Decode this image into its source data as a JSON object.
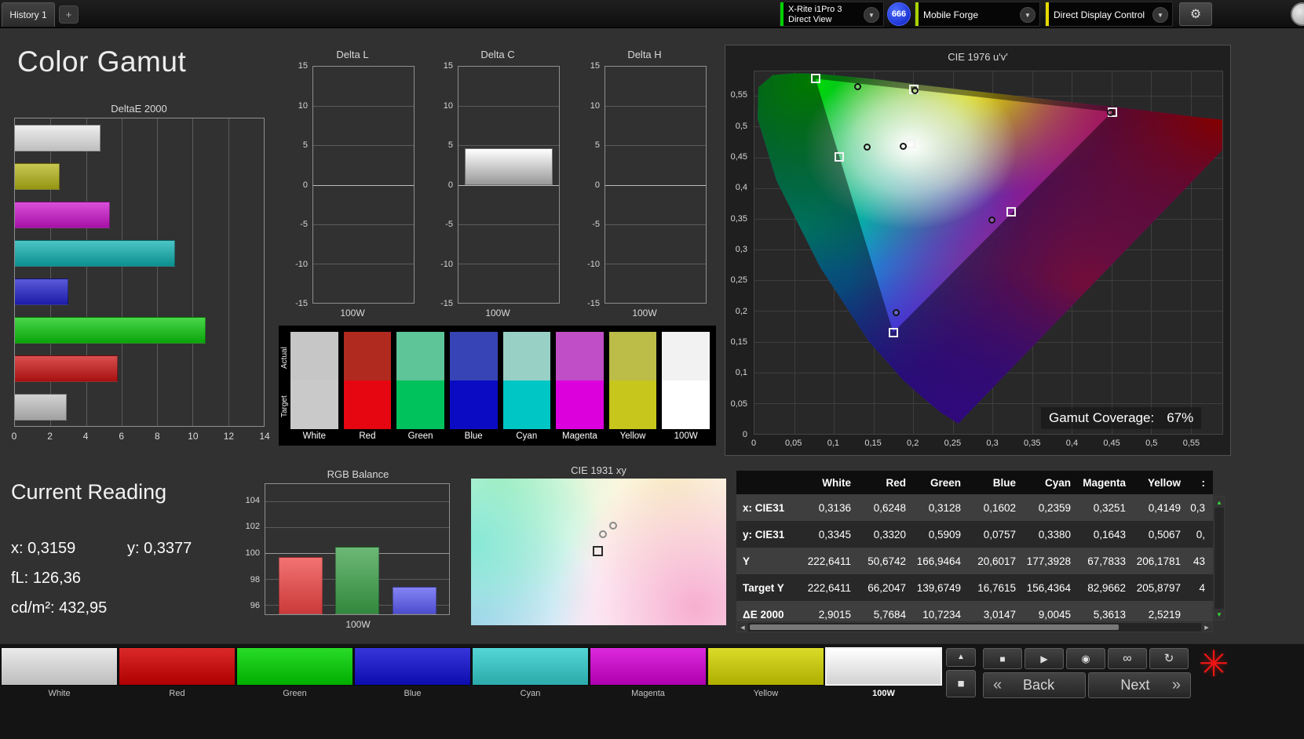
{
  "colors": {
    "accent_green": "#00d200",
    "accent_lime": "#a8d400",
    "accent_yellow": "#e8d800",
    "badge_blue": "#1f3fe8",
    "asterisk_red": "#f01414"
  },
  "icons": {
    "gear": "⚙",
    "chevron_down": "▼",
    "triangle_up": "▲",
    "triangle_down": "▼",
    "triangle_left": "◀",
    "triangle_right": "▶",
    "square": "■",
    "stop": "■",
    "play": "▶",
    "record": "◉",
    "infinity": "∞",
    "refresh": "↻",
    "asterisk": "✳"
  },
  "topbar": {
    "history_tab": "History 1",
    "add_tab": "+",
    "meter_line1": "X-Rite i1Pro 3",
    "meter_line2": "Direct View",
    "badge": "666",
    "pattern_source": "Mobile Forge",
    "display_control": "Direct Display Control"
  },
  "page_title": "Color Gamut",
  "chart_data": [
    {
      "id": "deltae2000",
      "type": "bar",
      "orientation": "horizontal",
      "title": "DeltaE 2000",
      "categories": [
        "100W",
        "Yellow",
        "Magenta",
        "Cyan",
        "Blue",
        "Green",
        "Red",
        "White"
      ],
      "values": [
        4.8,
        2.5219,
        5.3613,
        9.0045,
        3.0147,
        10.7234,
        5.7684,
        2.9015
      ],
      "bar_colors": [
        "#e8e8e8",
        "#b5b518",
        "#cc14cc",
        "#0fb0b0",
        "#2222cc",
        "#0cc80c",
        "#cc1414",
        "#c4c4c4"
      ],
      "xlim": [
        0,
        14
      ],
      "xticks": [
        0,
        2,
        4,
        6,
        8,
        10,
        12,
        14
      ]
    },
    {
      "id": "delta_l",
      "type": "bar",
      "title": "Delta L",
      "categories": [
        "100W"
      ],
      "values": [
        0
      ],
      "ylim": [
        -15,
        15
      ],
      "yticks": [
        15,
        10,
        5,
        0,
        -5,
        -10,
        -15
      ],
      "xlabel": "100W"
    },
    {
      "id": "delta_c",
      "type": "bar",
      "title": "Delta C",
      "categories": [
        "100W"
      ],
      "values": [
        4.6
      ],
      "ylim": [
        -15,
        15
      ],
      "yticks": [
        15,
        10,
        5,
        0,
        -5,
        -10,
        -15
      ],
      "xlabel": "100W"
    },
    {
      "id": "delta_h",
      "type": "bar",
      "title": "Delta H",
      "categories": [
        "100W"
      ],
      "values": [
        0
      ],
      "ylim": [
        -15,
        15
      ],
      "yticks": [
        15,
        10,
        5,
        0,
        -5,
        -10,
        -15
      ],
      "xlabel": "100W"
    },
    {
      "id": "rgb_balance",
      "type": "bar",
      "title": "RGB Balance",
      "categories": [
        "Red",
        "Green",
        "Blue"
      ],
      "values": [
        99.7,
        100.5,
        97.4
      ],
      "bar_colors": [
        "#ee4444",
        "#3ba048",
        "#5b5bf2"
      ],
      "ylim": [
        95.3,
        105.3
      ],
      "yticks": [
        104,
        102,
        100,
        98,
        96
      ],
      "xlabel": "100W"
    },
    {
      "id": "cie1976",
      "type": "scatter",
      "title": "CIE 1976 u'v'",
      "xlim": [
        0,
        0.59
      ],
      "ylim": [
        0,
        0.59
      ],
      "xticks": [
        {
          "v": 0,
          "label": "0"
        },
        {
          "v": 0.05,
          "label": "0,05"
        },
        {
          "v": 0.1,
          "label": "0,1"
        },
        {
          "v": 0.15,
          "label": "0,15"
        },
        {
          "v": 0.2,
          "label": "0,2"
        },
        {
          "v": 0.25,
          "label": "0,25"
        },
        {
          "v": 0.3,
          "label": "0,3"
        },
        {
          "v": 0.35,
          "label": "0,35"
        },
        {
          "v": 0.4,
          "label": "0,4"
        },
        {
          "v": 0.45,
          "label": "0,45"
        },
        {
          "v": 0.5,
          "label": "0,5"
        },
        {
          "v": 0.55,
          "label": "0,55"
        }
      ],
      "yticks": [
        {
          "v": 0.55,
          "label": "0,55"
        },
        {
          "v": 0.5,
          "label": "0,5"
        },
        {
          "v": 0.45,
          "label": "0,45"
        },
        {
          "v": 0.4,
          "label": "0,4"
        },
        {
          "v": 0.35,
          "label": "0,35"
        },
        {
          "v": 0.3,
          "label": "0,3"
        },
        {
          "v": 0.25,
          "label": "0,25"
        },
        {
          "v": 0.2,
          "label": "0,2"
        },
        {
          "v": 0.15,
          "label": "0,15"
        },
        {
          "v": 0.1,
          "label": "0,1"
        },
        {
          "v": 0.05,
          "label": "0,05"
        },
        {
          "v": 0,
          "label": "0"
        }
      ],
      "targets": [
        {
          "name": "green",
          "u": 0.077,
          "v": 0.578
        },
        {
          "name": "yellow",
          "u": 0.201,
          "v": 0.561
        },
        {
          "name": "red",
          "u": 0.451,
          "v": 0.524
        },
        {
          "name": "white",
          "u": 0.197,
          "v": 0.472
        },
        {
          "name": "cyan",
          "u": 0.107,
          "v": 0.451
        },
        {
          "name": "magenta",
          "u": 0.324,
          "v": 0.362
        },
        {
          "name": "blue",
          "u": 0.175,
          "v": 0.165
        }
      ],
      "measurements": [
        {
          "name": "green",
          "u": 0.131,
          "v": 0.564
        },
        {
          "name": "yellow",
          "u": 0.203,
          "v": 0.558
        },
        {
          "name": "red",
          "u": 0.449,
          "v": 0.522
        },
        {
          "name": "white",
          "u": 0.188,
          "v": 0.468
        },
        {
          "name": "cyan",
          "u": 0.143,
          "v": 0.466
        },
        {
          "name": "magenta",
          "u": 0.3,
          "v": 0.347
        },
        {
          "name": "blue",
          "u": 0.179,
          "v": 0.197
        }
      ],
      "coverage_label": "Gamut Coverage:",
      "coverage_value": "67%"
    },
    {
      "id": "cie1931",
      "type": "scatter",
      "title": "CIE 1931 xy",
      "measurements_pct": [
        {
          "x": 51.7,
          "y": 37.8
        },
        {
          "x": 55.7,
          "y": 31.9
        }
      ],
      "target_pct": {
        "x": 49.8,
        "y": 49.7
      }
    }
  ],
  "swatch_panel": {
    "row_labels": [
      "Actual",
      "Target"
    ],
    "columns": [
      {
        "label": "White",
        "actual": "#c6c6c6",
        "target": "#c9c9c9"
      },
      {
        "label": "Red",
        "actual": "#b02a20",
        "target": "#e60611"
      },
      {
        "label": "Green",
        "actual": "#5ec598",
        "target": "#00c25d"
      },
      {
        "label": "Blue",
        "actual": "#3744b5",
        "target": "#0b0bc4"
      },
      {
        "label": "Cyan",
        "actual": "#98d0c6",
        "target": "#00c6c6"
      },
      {
        "label": "Magenta",
        "actual": "#c04ec6",
        "target": "#dc00dc"
      },
      {
        "label": "Yellow",
        "actual": "#bcbc48",
        "target": "#c6c61c"
      },
      {
        "label": "100W",
        "actual": "#f2f2f2",
        "target": "#ffffff"
      }
    ]
  },
  "current_reading": {
    "title": "Current Reading",
    "x_label": "x:",
    "x_value": "0,3159",
    "y_label": "y:",
    "y_value": "0,3377",
    "fl_label": "fL:",
    "fl_value": "126,36",
    "cd_label": "cd/m²:",
    "cd_value": "432,95"
  },
  "table": {
    "headers": [
      "",
      "White",
      "Red",
      "Green",
      "Blue",
      "Cyan",
      "Magenta",
      "Yellow",
      ":"
    ],
    "rows": [
      {
        "label": "x: CIE31",
        "values": [
          "0,3136",
          "0,6248",
          "0,3128",
          "0,1602",
          "0,2359",
          "0,3251",
          "0,4149",
          "0,3"
        ]
      },
      {
        "label": "y: CIE31",
        "values": [
          "0,3345",
          "0,3320",
          "0,5909",
          "0,0757",
          "0,3380",
          "0,1643",
          "0,5067",
          "0,"
        ]
      },
      {
        "label": "Y",
        "values": [
          "222,6411",
          "50,6742",
          "166,9464",
          "20,6017",
          "177,3928",
          "67,7833",
          "206,1781",
          "43"
        ]
      },
      {
        "label": "Target Y",
        "values": [
          "222,6411",
          "66,2047",
          "139,6749",
          "16,7615",
          "156,4364",
          "82,9662",
          "205,8797",
          "4"
        ]
      },
      {
        "label": "ΔE 2000",
        "values": [
          "2,9015",
          "5,7684",
          "10,7234",
          "3,0147",
          "9,0045",
          "5,3613",
          "2,5219",
          ""
        ]
      }
    ]
  },
  "bottom_bar": {
    "swatches": [
      {
        "label": "White",
        "color": "#e6e6e6"
      },
      {
        "label": "Red",
        "color": "#d40000"
      },
      {
        "label": "Green",
        "color": "#00d400"
      },
      {
        "label": "Blue",
        "color": "#0f0fd4"
      },
      {
        "label": "Cyan",
        "color": "#35cfcf"
      },
      {
        "label": "Magenta",
        "color": "#d400d4"
      },
      {
        "label": "Yellow",
        "color": "#d4d400"
      },
      {
        "label": "100W",
        "color": "#ffffff",
        "selected": true
      }
    ],
    "back_chevron": "«",
    "back_label": "Back",
    "next_label": "Next",
    "next_chevron": "»"
  }
}
